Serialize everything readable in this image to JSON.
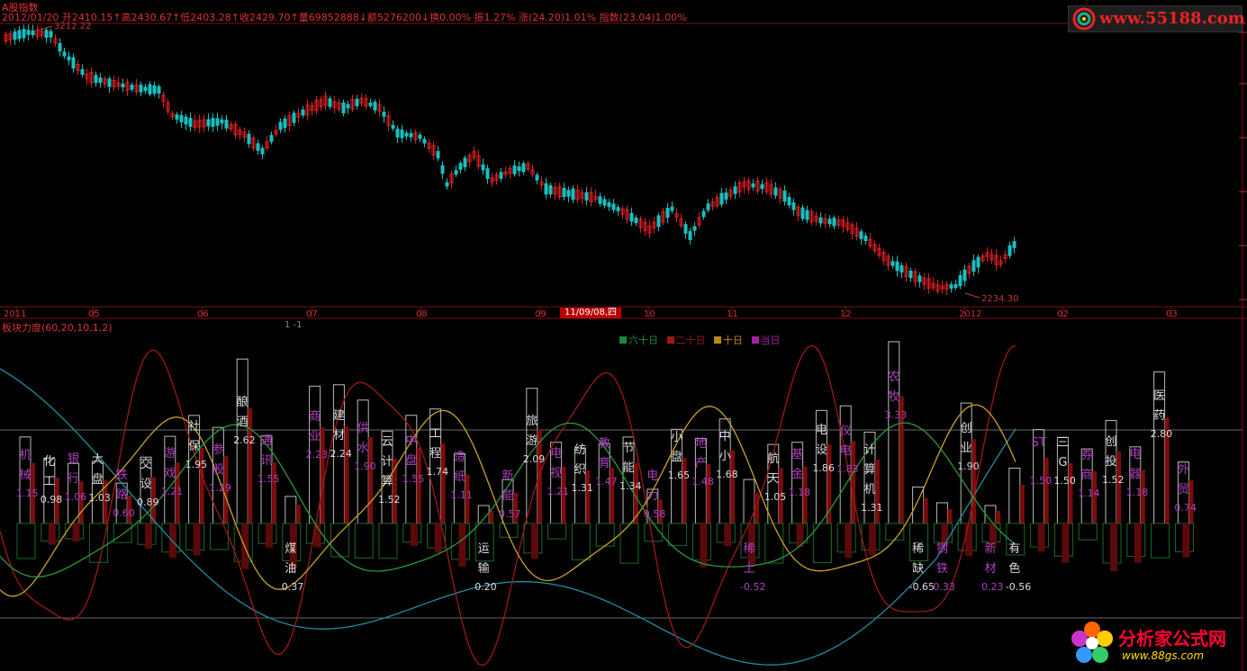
{
  "header": {
    "title": "A股指数",
    "info": "2012/01/20 开2410.15↑高2430.67↑低2403.28↑收2429.70↑量69852888↓额5276200↓换0.00% 振1.27% 涨(24.20)1.01% 指数(23.04)1.00%"
  },
  "price_chart": {
    "high_label": "3212.22",
    "low_label": "2234.30",
    "months": [
      "2011",
      "05",
      "06",
      "07",
      "08",
      "09",
      "10",
      "11",
      "12",
      "2012",
      "02",
      "03"
    ],
    "cursor_date": "11/09/08,四"
  },
  "indicator": {
    "title": "板块力度(60,20,10,1,2)",
    "sub": "1 -1",
    "legend": [
      {
        "label": "六十日",
        "color": "#1a8a3a"
      },
      {
        "label": "二十日",
        "color": "#a01818"
      },
      {
        "label": "十日",
        "color": "#b8861b"
      },
      {
        "label": "当日",
        "color": "#a020a0"
      }
    ]
  },
  "sectors": [
    {
      "name": "机械",
      "value": "1.15",
      "purple": true
    },
    {
      "name": "化工",
      "value": "0.98",
      "purple": false
    },
    {
      "name": "银行",
      "value": "1.06",
      "purple": true
    },
    {
      "name": "大盘",
      "value": "1.03",
      "purple": false
    },
    {
      "name": "铁路",
      "value": "0.60",
      "purple": true
    },
    {
      "name": "交设",
      "value": "0.89",
      "purple": false
    },
    {
      "name": "游戏",
      "value": "1.21",
      "purple": true
    },
    {
      "name": "社保",
      "value": "1.95",
      "purple": false
    },
    {
      "name": "参股",
      "value": "1.29",
      "purple": true
    },
    {
      "name": "酿酒",
      "value": "2.62",
      "purple": false
    },
    {
      "name": "通讯",
      "value": "1.55",
      "purple": true
    },
    {
      "name": "煤油",
      "value": "0.37",
      "purple": false
    },
    {
      "name": "商业",
      "value": "2.23",
      "purple": true
    },
    {
      "name": "建材",
      "value": "2.24",
      "purple": false
    },
    {
      "name": "供水",
      "value": "1.90",
      "purple": true
    },
    {
      "name": "云计算",
      "value": "1.52",
      "purple": false
    },
    {
      "name": "中盘",
      "value": "1.55",
      "purple": true
    },
    {
      "name": "工程",
      "value": "1.74",
      "purple": false
    },
    {
      "name": "造纸",
      "value": "1.11",
      "purple": true
    },
    {
      "name": "运输",
      "value": "0.20",
      "purple": false
    },
    {
      "name": "新能",
      "value": "0.57",
      "purple": true
    },
    {
      "name": "旅游",
      "value": "2.09",
      "purple": false
    },
    {
      "name": "电视",
      "value": "1.21",
      "purple": true
    },
    {
      "name": "纺织",
      "value": "1.31",
      "purple": false
    },
    {
      "name": "教育",
      "value": "1.47",
      "purple": true
    },
    {
      "name": "节能",
      "value": "1.34",
      "purple": false
    },
    {
      "name": "电力",
      "value": "0.58",
      "purple": true
    },
    {
      "name": "小盘",
      "value": "1.65",
      "purple": false
    },
    {
      "name": "地产",
      "value": "1.48",
      "purple": true
    },
    {
      "name": "中小",
      "value": "1.68",
      "purple": false
    },
    {
      "name": "稀土",
      "value": "-0.52",
      "purple": true
    },
    {
      "name": "航天",
      "value": "1.05",
      "purple": false
    },
    {
      "name": "基金",
      "value": "1.18",
      "purple": true
    },
    {
      "name": "电设",
      "value": "1.86",
      "purple": false
    },
    {
      "name": "仪电",
      "value": "1.83",
      "purple": true
    },
    {
      "name": "计算机",
      "value": "1.31",
      "purple": false
    },
    {
      "name": "农牧",
      "value": "3.33",
      "purple": true
    },
    {
      "name": "稀缺",
      "value": "-0.65",
      "purple": false
    },
    {
      "name": "钢铁",
      "value": "0.33",
      "purple": true
    },
    {
      "name": "创业",
      "value": "1.90",
      "purple": false
    },
    {
      "name": "新材",
      "value": "0.23",
      "purple": true
    },
    {
      "name": "有色",
      "value": "-0.56",
      "purple": false
    },
    {
      "name": "ST",
      "value": "1.50",
      "purple": true
    },
    {
      "name": "三G",
      "value": "1.50",
      "purple": false
    },
    {
      "name": "券商",
      "value": "1.14",
      "purple": true
    },
    {
      "name": "创投",
      "value": "1.52",
      "purple": false
    },
    {
      "name": "电器",
      "value": "1.18",
      "purple": true
    },
    {
      "name": "医药",
      "value": "2.80",
      "purple": false
    },
    {
      "name": "外贸",
      "value": "0.74",
      "purple": true
    }
  ],
  "branding": {
    "top_url": "www.55188.com",
    "bottom_name": "分析家公式网",
    "bottom_url": "www.88gs.com"
  }
}
